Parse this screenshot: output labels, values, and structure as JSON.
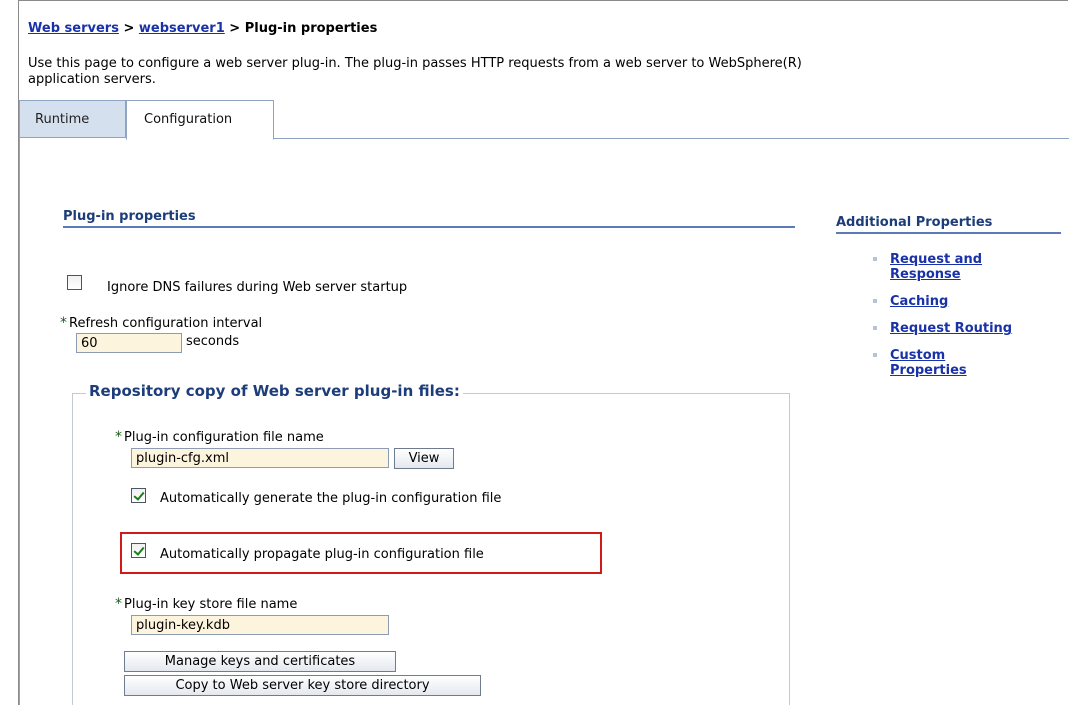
{
  "breadcrumb": {
    "items": [
      "Web servers",
      "webserver1",
      "Plug-in properties"
    ],
    "separator": ">"
  },
  "description": {
    "line1": "Use this page to configure a web server plug-in. The plug-in passes HTTP requests from a web server to WebSphere(R)",
    "line2": "application servers."
  },
  "tabs": [
    {
      "label": "Runtime",
      "active": false
    },
    {
      "label": "Configuration",
      "active": true
    }
  ],
  "plugin_properties": {
    "title": "Plug-in properties",
    "ignore_dns": {
      "label": "Ignore DNS failures during Web server startup",
      "checked": false
    },
    "refresh_interval": {
      "label": "Refresh configuration interval",
      "value": "60",
      "unit": "seconds",
      "required": true
    }
  },
  "repository": {
    "legend": "Repository copy of Web server plug-in files:",
    "config_file": {
      "label": "Plug-in configuration file name",
      "value": "plugin-cfg.xml",
      "required": true,
      "view_button": "View"
    },
    "auto_generate": {
      "label": "Automatically generate the plug-in configuration file",
      "checked": true
    },
    "auto_propagate": {
      "label": "Automatically propagate plug-in configuration file",
      "checked": true
    },
    "key_store": {
      "label": "Plug-in key store file name",
      "value": "plugin-key.kdb",
      "required": true
    },
    "manage_keys_button": "Manage keys and certificates",
    "copy_keystore_button": "Copy to Web server key store directory"
  },
  "additional_properties": {
    "title": "Additional Properties",
    "links": [
      {
        "line1": "Request and",
        "line2": "Response"
      },
      {
        "line1": "Caching",
        "line2": ""
      },
      {
        "line1": "Request Routing",
        "line2": ""
      },
      {
        "line1": "Custom",
        "line2": "Properties"
      }
    ]
  },
  "colors": {
    "link": "#1a32a8",
    "section_title": "#1d3d7a",
    "input_bg": "#fdf4dd",
    "highlight": "#d01919",
    "tab_inactive": "#d5e0ee"
  }
}
